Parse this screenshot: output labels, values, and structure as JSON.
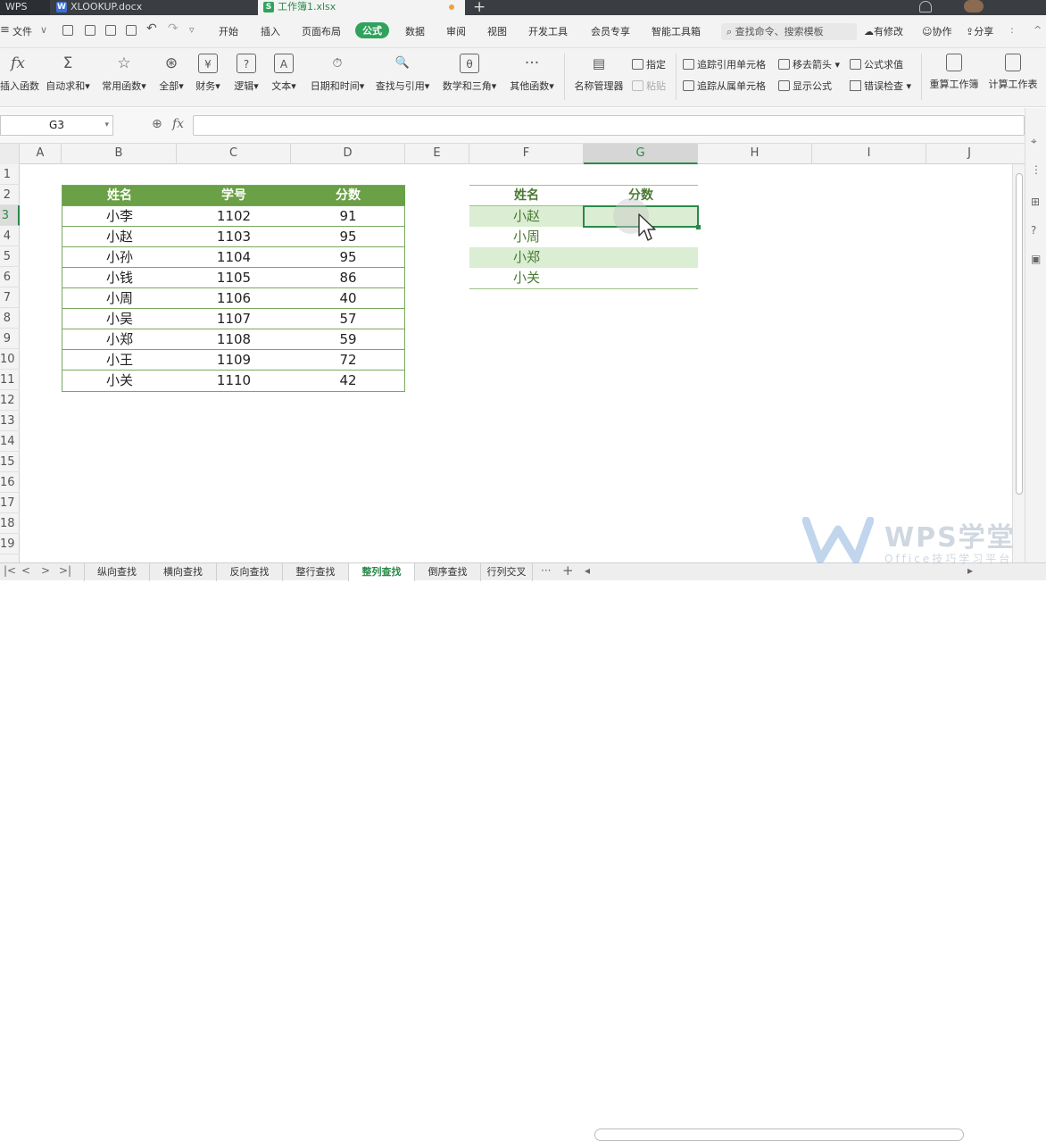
{
  "titlebar": {
    "app": "WPS",
    "tabs": [
      {
        "label": "XLOOKUP.docx",
        "icon": "W"
      },
      {
        "label": "工作簿1.xlsx",
        "icon": "S"
      }
    ],
    "new_tab": "+"
  },
  "menubar": {
    "file": "文件",
    "items": [
      "开始",
      "插入",
      "页面布局",
      "公式",
      "数据",
      "审阅",
      "视图",
      "开发工具",
      "会员专享",
      "智能工具箱"
    ],
    "active": "公式",
    "search_placeholder": "查找命令、搜索模板",
    "right": [
      "有修改",
      "协作",
      "分享"
    ]
  },
  "ribbon": {
    "buttons": [
      {
        "label": "插入函数",
        "icon": "fx"
      },
      {
        "label": "自动求和",
        "icon": "Σ"
      },
      {
        "label": "常用函数",
        "icon": "☆"
      },
      {
        "label": "全部",
        "icon": "⊛"
      },
      {
        "label": "财务",
        "icon": "¥"
      },
      {
        "label": "逻辑",
        "icon": "?"
      },
      {
        "label": "文本",
        "icon": "A"
      },
      {
        "label": "日期和时间",
        "icon": "⏱"
      },
      {
        "label": "查找与引用",
        "icon": "🔍"
      },
      {
        "label": "数学和三角",
        "icon": "θ"
      },
      {
        "label": "其他函数",
        "icon": "···"
      },
      {
        "label": "名称管理器",
        "icon": "▤"
      }
    ],
    "small": [
      "指定",
      "粘贴",
      "追踪引用单元格",
      "追踪从属单元格",
      "移去箭头",
      "显示公式",
      "公式求值",
      "错误检查"
    ],
    "right_buttons": [
      "重算工作簿",
      "计算工作表"
    ]
  },
  "formulabar": {
    "namebox": "G3",
    "fx": "fx",
    "zoom_icon": "⊕"
  },
  "grid": {
    "columns": [
      "A",
      "B",
      "C",
      "D",
      "E",
      "F",
      "G",
      "H",
      "I",
      "J"
    ],
    "rows": [
      "1",
      "2",
      "3",
      "4",
      "5",
      "6",
      "7",
      "8",
      "9",
      "10",
      "11",
      "12",
      "13",
      "14",
      "15",
      "16",
      "17",
      "18",
      "19"
    ],
    "selected_col": "G",
    "selected_row": "3"
  },
  "table1": {
    "headers": [
      "姓名",
      "学号",
      "分数"
    ],
    "rows": [
      [
        "小李",
        "1102",
        "91"
      ],
      [
        "小赵",
        "1103",
        "95"
      ],
      [
        "小孙",
        "1104",
        "95"
      ],
      [
        "小钱",
        "1105",
        "86"
      ],
      [
        "小周",
        "1106",
        "40"
      ],
      [
        "小吴",
        "1107",
        "57"
      ],
      [
        "小郑",
        "1108",
        "59"
      ],
      [
        "小王",
        "1109",
        "72"
      ],
      [
        "小关",
        "1110",
        "42"
      ]
    ]
  },
  "table2": {
    "headers": [
      "姓名",
      "分数"
    ],
    "rows": [
      [
        "小赵",
        ""
      ],
      [
        "小周",
        ""
      ],
      [
        "小郑",
        ""
      ],
      [
        "小关",
        ""
      ]
    ]
  },
  "sheets": [
    "纵向查找",
    "横向查找",
    "反向查找",
    "整行查找",
    "整列查找",
    "倒序查找",
    "行列交叉"
  ],
  "active_sheet": "整列查找",
  "watermark": {
    "title": "WPS学堂",
    "subtitle": "Office技巧学习平台"
  },
  "colors": {
    "accent": "#2fa35c",
    "table_header": "#6aa046",
    "band": "#dbeed3"
  }
}
